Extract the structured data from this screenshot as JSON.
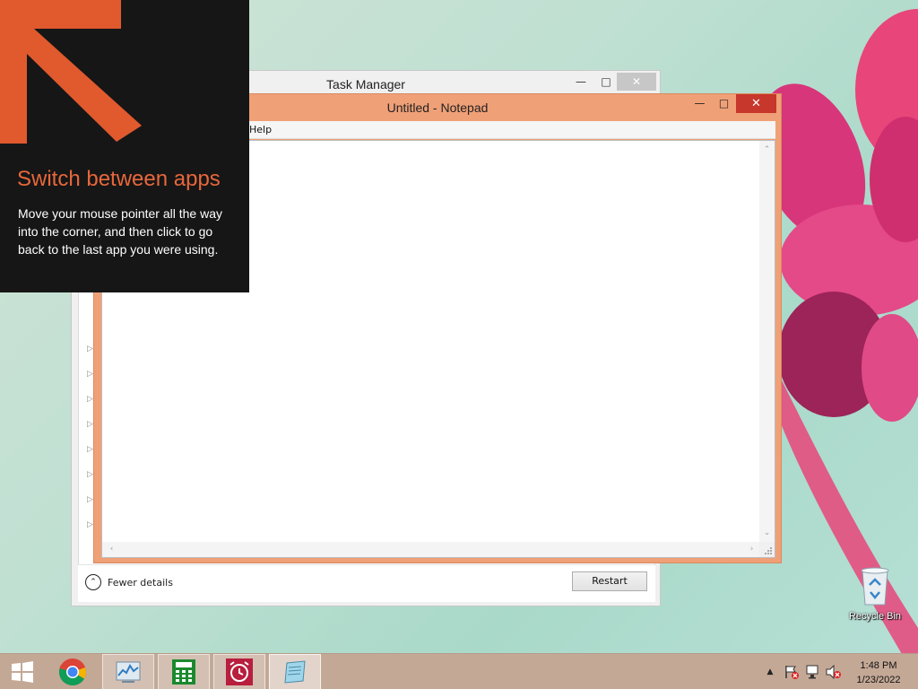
{
  "task_manager": {
    "title": "Task Manager",
    "minimize_glyph": "🗕",
    "maximize_glyph": "🗖",
    "close_glyph": "✕",
    "fewer_details_label": "Fewer details",
    "restart_label": "Restart",
    "expand_arrow_glyph": "▷"
  },
  "notepad": {
    "title": "Untitled - Notepad",
    "menu_visible_label": "Help",
    "minimize_glyph": "🗕",
    "maximize_glyph": "🗖",
    "close_glyph": "✕",
    "text_content": ""
  },
  "tip": {
    "title": "Switch between apps",
    "body": "Move your mouse pointer all the way into the corner, and then click to go back to the last app you were using."
  },
  "desktop": {
    "recycle_bin_label": "Recycle Bin"
  },
  "taskbar": {
    "apps": [
      {
        "name": "start-button",
        "icon": "windows-logo-icon"
      },
      {
        "name": "chrome",
        "icon": "chrome-icon"
      },
      {
        "name": "task-manager",
        "icon": "task-manager-icon",
        "state": "running"
      },
      {
        "name": "calculator",
        "icon": "calculator-icon",
        "state": "running"
      },
      {
        "name": "alarms",
        "icon": "alarm-clock-icon",
        "state": "running"
      },
      {
        "name": "notepad",
        "icon": "notepad-icon",
        "state": "active"
      }
    ],
    "tray": {
      "show_hidden_glyph": "▲",
      "time": "1:48 PM",
      "date": "1/23/2022"
    }
  },
  "colors": {
    "notepad_frame": "#f0a077",
    "close_red": "#c7372b",
    "tip_background": "#161616",
    "tip_accent": "#e8673c",
    "taskbar": "#c4a896"
  }
}
